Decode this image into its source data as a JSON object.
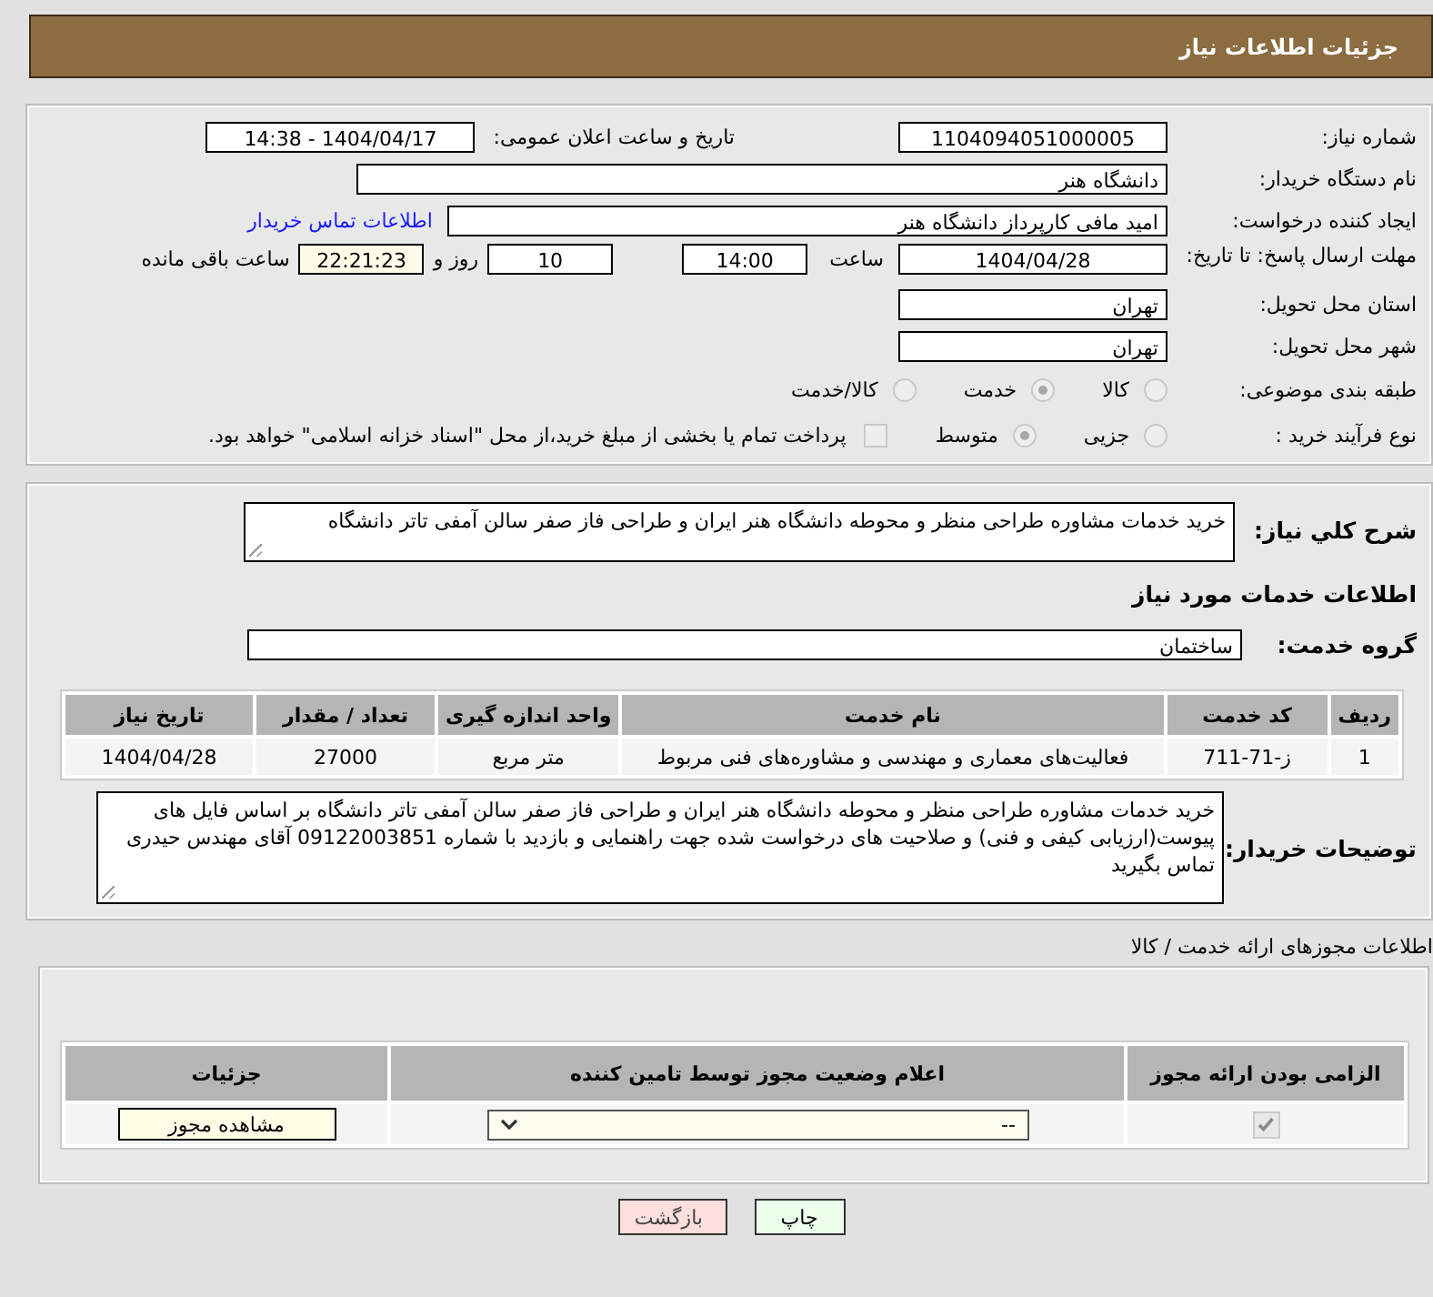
{
  "header": {
    "title": "جزئیات اطلاعات نیاز"
  },
  "details": {
    "need_number": {
      "label": "شماره نیاز:",
      "value": "1104094051000005"
    },
    "announce": {
      "label": "تاریخ و ساعت اعلان عمومی:",
      "value": "1404/04/17 - 14:38"
    },
    "buyer": {
      "label": "نام دستگاه خریدار:",
      "value": "دانشگاه هنر"
    },
    "creator": {
      "label": "ایجاد کننده درخواست:",
      "value": "امید مافی کارپرداز دانشگاه هنر",
      "link": "اطلاعات تماس خریدار"
    },
    "deadline": {
      "label": "مهلت ارسال پاسخ: تا تاریخ:",
      "date": "1404/04/28",
      "time_label": "ساعت",
      "time": "14:00",
      "days": "10",
      "days_label": "روز و",
      "remaining": "22:21:23",
      "remaining_label": "ساعت باقی مانده"
    },
    "province": {
      "label": "استان محل تحویل:",
      "value": "تهران"
    },
    "city": {
      "label": "شهر محل تحویل:",
      "value": "تهران"
    },
    "category": {
      "label": "طبقه بندی موضوعی:",
      "options": [
        {
          "label": "کالا",
          "selected": false
        },
        {
          "label": "خدمت",
          "selected": true
        },
        {
          "label": "کالا/خدمت",
          "selected": false
        }
      ]
    },
    "process": {
      "label": "نوع فرآیند خرید :",
      "options": [
        {
          "label": "جزیی",
          "selected": false
        },
        {
          "label": "متوسط",
          "selected": true
        }
      ],
      "payment": {
        "label": "پرداخت تمام یا بخشی از مبلغ خرید،از محل \"اسناد خزانه اسلامی\" خواهد بود.",
        "checked": false
      }
    }
  },
  "services": {
    "summary": {
      "label": "شرح کلي نیاز:",
      "value": "خرید خدمات مشاوره طراحی منظر و محوطه دانشگاه هنر ایران و طراحی فاز صفر سالن آمفی تاتر دانشگاه"
    },
    "heading": "اطلاعات خدمات مورد نیاز",
    "group": {
      "label": "گروه خدمت:",
      "value": "ساختمان"
    },
    "table": {
      "columns": [
        "ردیف",
        "کد خدمت",
        "نام خدمت",
        "واحد اندازه گیری",
        "تعداد / مقدار",
        "تاریخ نیاز"
      ],
      "rows": [
        [
          "1",
          "ز-71-711",
          "فعالیت‌های معماری و مهندسی و مشاوره‌های فنی مربوط",
          "متر مربع",
          "27000",
          "1404/04/28"
        ]
      ]
    },
    "notes": {
      "label": "توضیحات خریدار:",
      "value": "خرید خدمات مشاوره طراحی منظر و محوطه دانشگاه هنر ایران و طراحی فاز صفر سالن آمفی تاتر دانشگاه بر اساس فایل های پیوست(ارزیابی کیفی و فنی) و صلاحیت های درخواست شده جهت راهنمایی و بازدید با شماره 09122003851 آقای مهندس حیدری تماس بگیرید"
    }
  },
  "permits": {
    "title": "اطلاعات مجوزهای ارائه خدمت / کالا",
    "columns": [
      "الزامی بودن ارائه مجوز",
      "اعلام وضعیت مجوز توسط تامین کننده",
      "جزئیات"
    ],
    "rows": [
      {
        "required": true,
        "status": "--",
        "details_button": "مشاهده مجوز"
      }
    ]
  },
  "actions": [
    {
      "kind": "print",
      "label": "چاپ"
    },
    {
      "kind": "back",
      "label": "بازگشت"
    }
  ]
}
